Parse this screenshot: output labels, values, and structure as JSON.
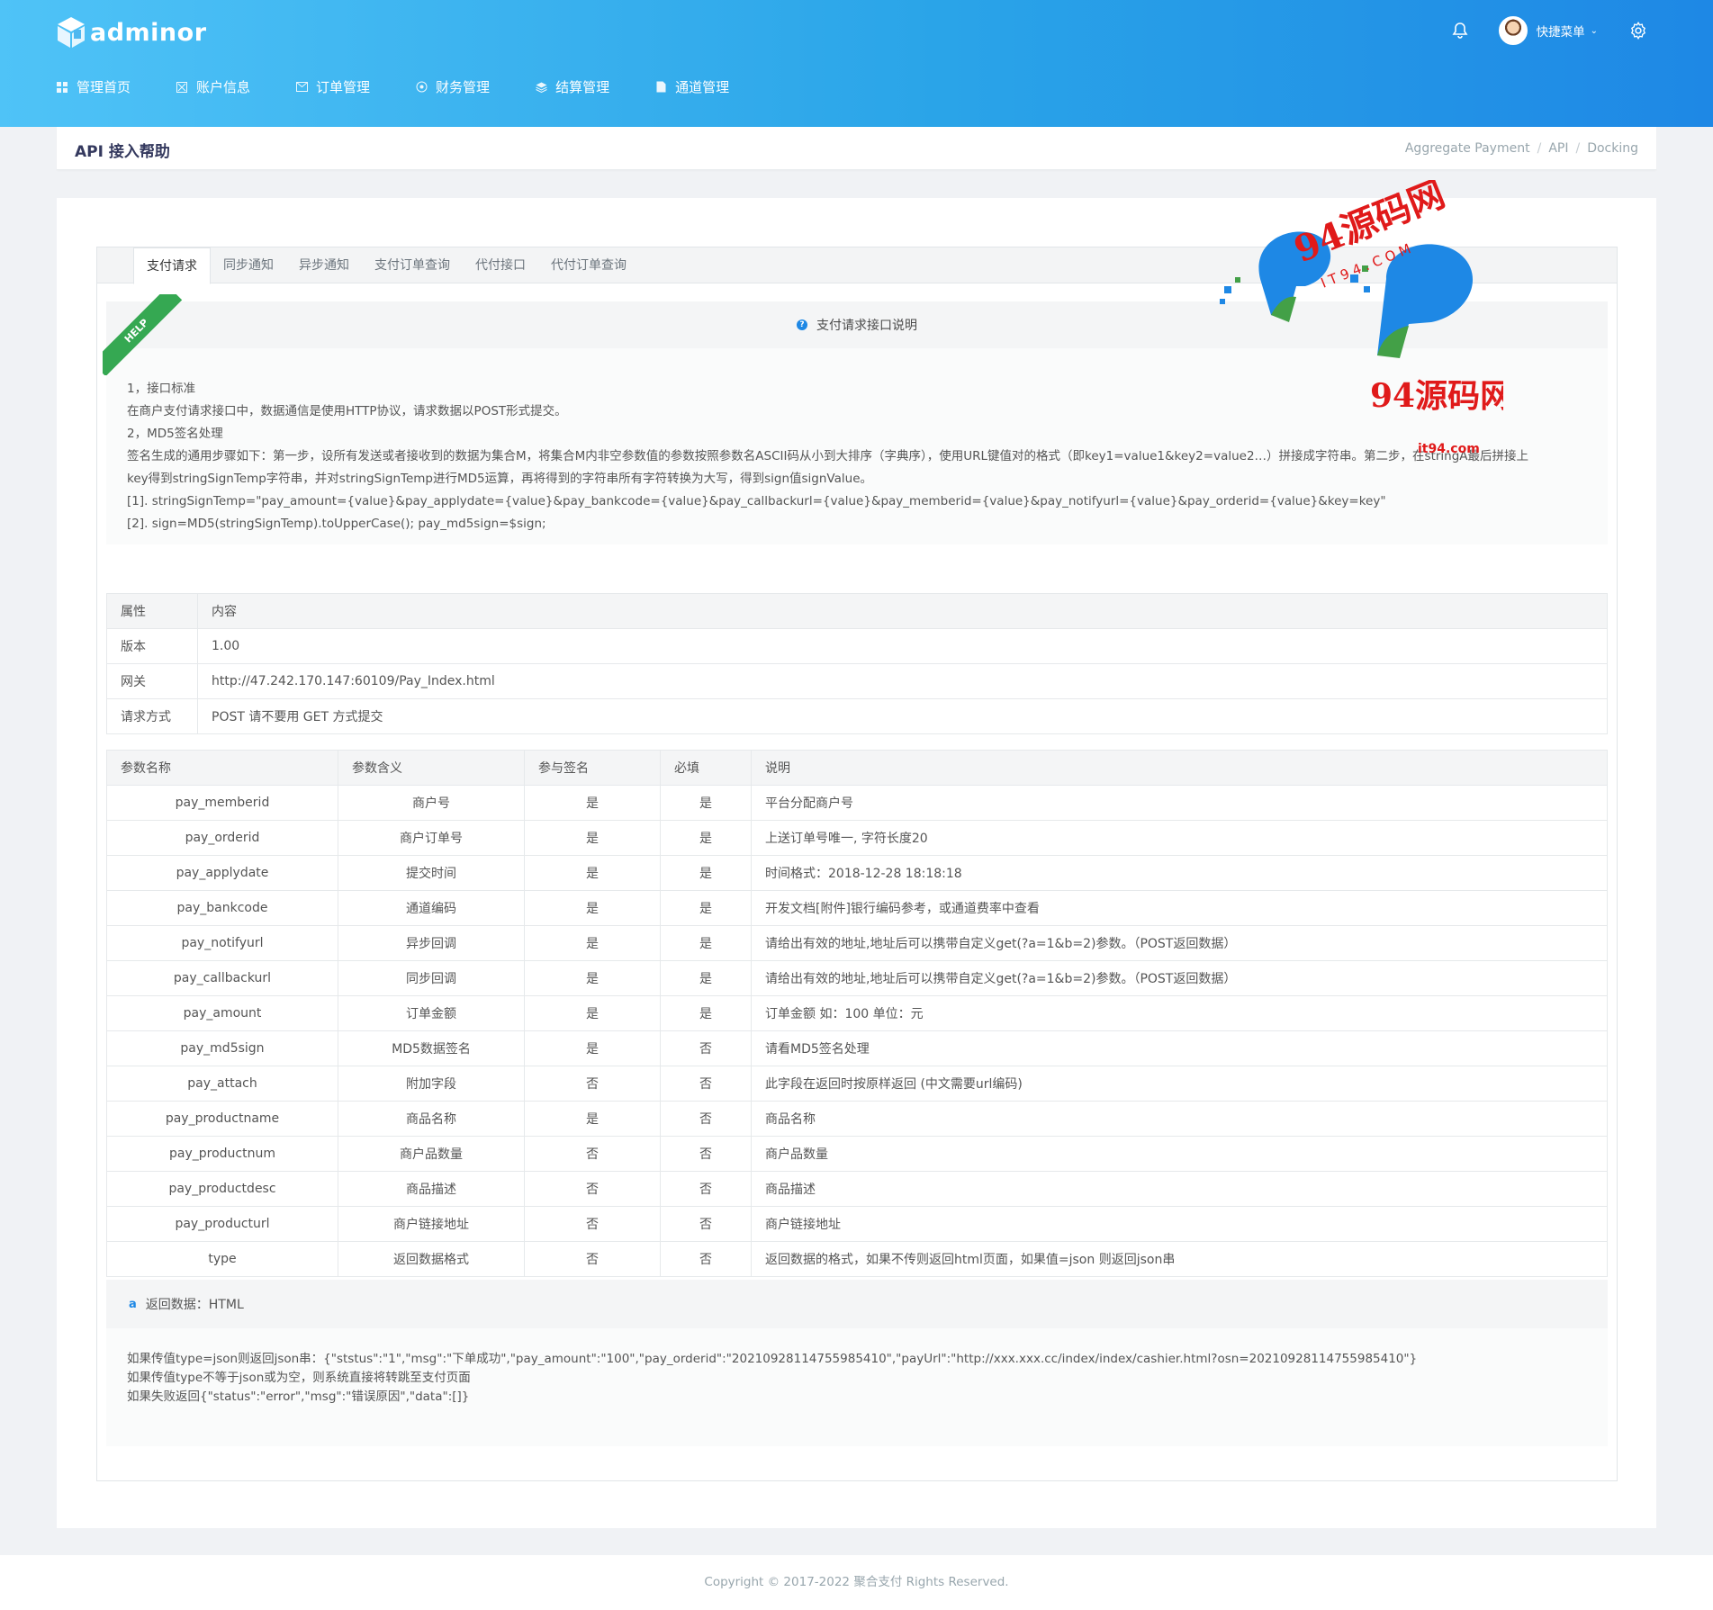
{
  "header": {
    "brand": "adminor",
    "quick_menu": "快捷菜单",
    "nav": [
      {
        "label": "管理首页",
        "icon": "dashboard-icon"
      },
      {
        "label": "账户信息",
        "icon": "account-icon"
      },
      {
        "label": "订单管理",
        "icon": "mail-icon"
      },
      {
        "label": "财务管理",
        "icon": "finance-icon"
      },
      {
        "label": "结算管理",
        "icon": "layers-icon"
      },
      {
        "label": "通道管理",
        "icon": "document-icon"
      }
    ]
  },
  "page": {
    "title": "API 接入帮助",
    "breadcrumb": [
      "Aggregate Payment",
      "API",
      "Docking"
    ]
  },
  "tabs": [
    "支付请求",
    "同步通知",
    "异步通知",
    "支付订单查询",
    "代付接口",
    "代付订单查询"
  ],
  "note": {
    "ribbon": "HELP",
    "heading": "支付请求接口说明",
    "lines": [
      "1，接口标准",
      "在商户支付请求接口中，数据通信是使用HTTP协议，请求数据以POST形式提交。",
      "2，MD5签名处理",
      "签名生成的通用步骤如下：第一步，设所有发送或者接收到的数据为集合M，将集合M内非空参数值的参数按照参数名ASCII码从小到大排序（字典序），使用URL键值对的格式（即key1=value1&key2=value2…）拼接成字符串。第二步，在stringA最后拼接上",
      "key得到stringSignTemp字符串，并对stringSignTemp进行MD5运算，再将得到的字符串所有字符转换为大写，得到sign值signValue。",
      "[1]. stringSignTemp=\"pay_amount={value}&pay_applydate={value}&pay_bankcode={value}&pay_callbackurl={value}&pay_memberid={value}&pay_notifyurl={value}&pay_orderid={value}&key=key\"",
      "[2]. sign=MD5(stringSignTemp).toUpperCase(); pay_md5sign=$sign;"
    ]
  },
  "info_table": {
    "headers": [
      "属性",
      "内容"
    ],
    "rows": [
      [
        "版本",
        "1.00"
      ],
      [
        "网关",
        "http://47.242.170.147:60109/Pay_Index.html"
      ],
      [
        "请求方式",
        "POST 请不要用 GET 方式提交"
      ]
    ]
  },
  "param_table": {
    "headers": [
      "参数名称",
      "参数含义",
      "参与签名",
      "必填",
      "说明"
    ],
    "rows": [
      [
        "pay_memberid",
        "商户号",
        "是",
        "是",
        "平台分配商户号"
      ],
      [
        "pay_orderid",
        "商户订单号",
        "是",
        "是",
        "上送订单号唯一, 字符长度20"
      ],
      [
        "pay_applydate",
        "提交时间",
        "是",
        "是",
        "时间格式：2018-12-28 18:18:18"
      ],
      [
        "pay_bankcode",
        "通道编码",
        "是",
        "是",
        "开发文档[附件]银行编码参考，或通道费率中查看"
      ],
      [
        "pay_notifyurl",
        "异步回调",
        "是",
        "是",
        "请给出有效的地址,地址后可以携带自定义get(?a=1&b=2)参数。（POST返回数据）"
      ],
      [
        "pay_callbackurl",
        "同步回调",
        "是",
        "是",
        "请给出有效的地址,地址后可以携带自定义get(?a=1&b=2)参数。（POST返回数据）"
      ],
      [
        "pay_amount",
        "订单金额",
        "是",
        "是",
        "订单金额 如：100 单位：元"
      ],
      [
        "pay_md5sign",
        "MD5数据签名",
        "是",
        "否",
        "请看MD5签名处理"
      ],
      [
        "pay_attach",
        "附加字段",
        "否",
        "否",
        "此字段在返回时按原样返回 (中文需要url编码)"
      ],
      [
        "pay_productname",
        "商品名称",
        "是",
        "否",
        "商品名称"
      ],
      [
        "pay_productnum",
        "商户品数量",
        "否",
        "否",
        "商户品数量"
      ],
      [
        "pay_productdesc",
        "商品描述",
        "否",
        "否",
        "商品描述"
      ],
      [
        "pay_producturl",
        "商户链接地址",
        "否",
        "否",
        "商户链接地址"
      ],
      [
        "type",
        "返回数据格式",
        "否",
        "否",
        "返回数据的格式，如果不传则返回html页面，如果值=json 则返回json串"
      ]
    ]
  },
  "return_data": {
    "heading": "返回数据：HTML",
    "lines": [
      "如果传值type=json则返回json串：{\"ststus\":\"1\",\"msg\":\"下单成功\",\"pay_amount\":\"100\",\"pay_orderid\":\"20210928114755985410\",\"payUrl\":\"http://xxx.xxx.cc/index/index/cashier.html?osn=20210928114755985410\"}",
      "如果传值type不等于json或为空，则系统直接将转跳至支付页面",
      "如果失败返回{\"status\":\"error\",\"msg\":\"错误原因\",\"data\":[]}"
    ]
  },
  "watermark": {
    "text_top": "94源码网",
    "subtext": "I T 9 4 . C O M",
    "text_bottom": "94源码网",
    "domain": "it94.com"
  },
  "footer": "Copyright © 2017-2022 聚合支付 Rights Reserved.",
  "colors": {
    "header_start": "#4fc3f7",
    "header_end": "#1e88e5",
    "ribbon": "#35a852",
    "watermark_red": "#e01a1a"
  }
}
